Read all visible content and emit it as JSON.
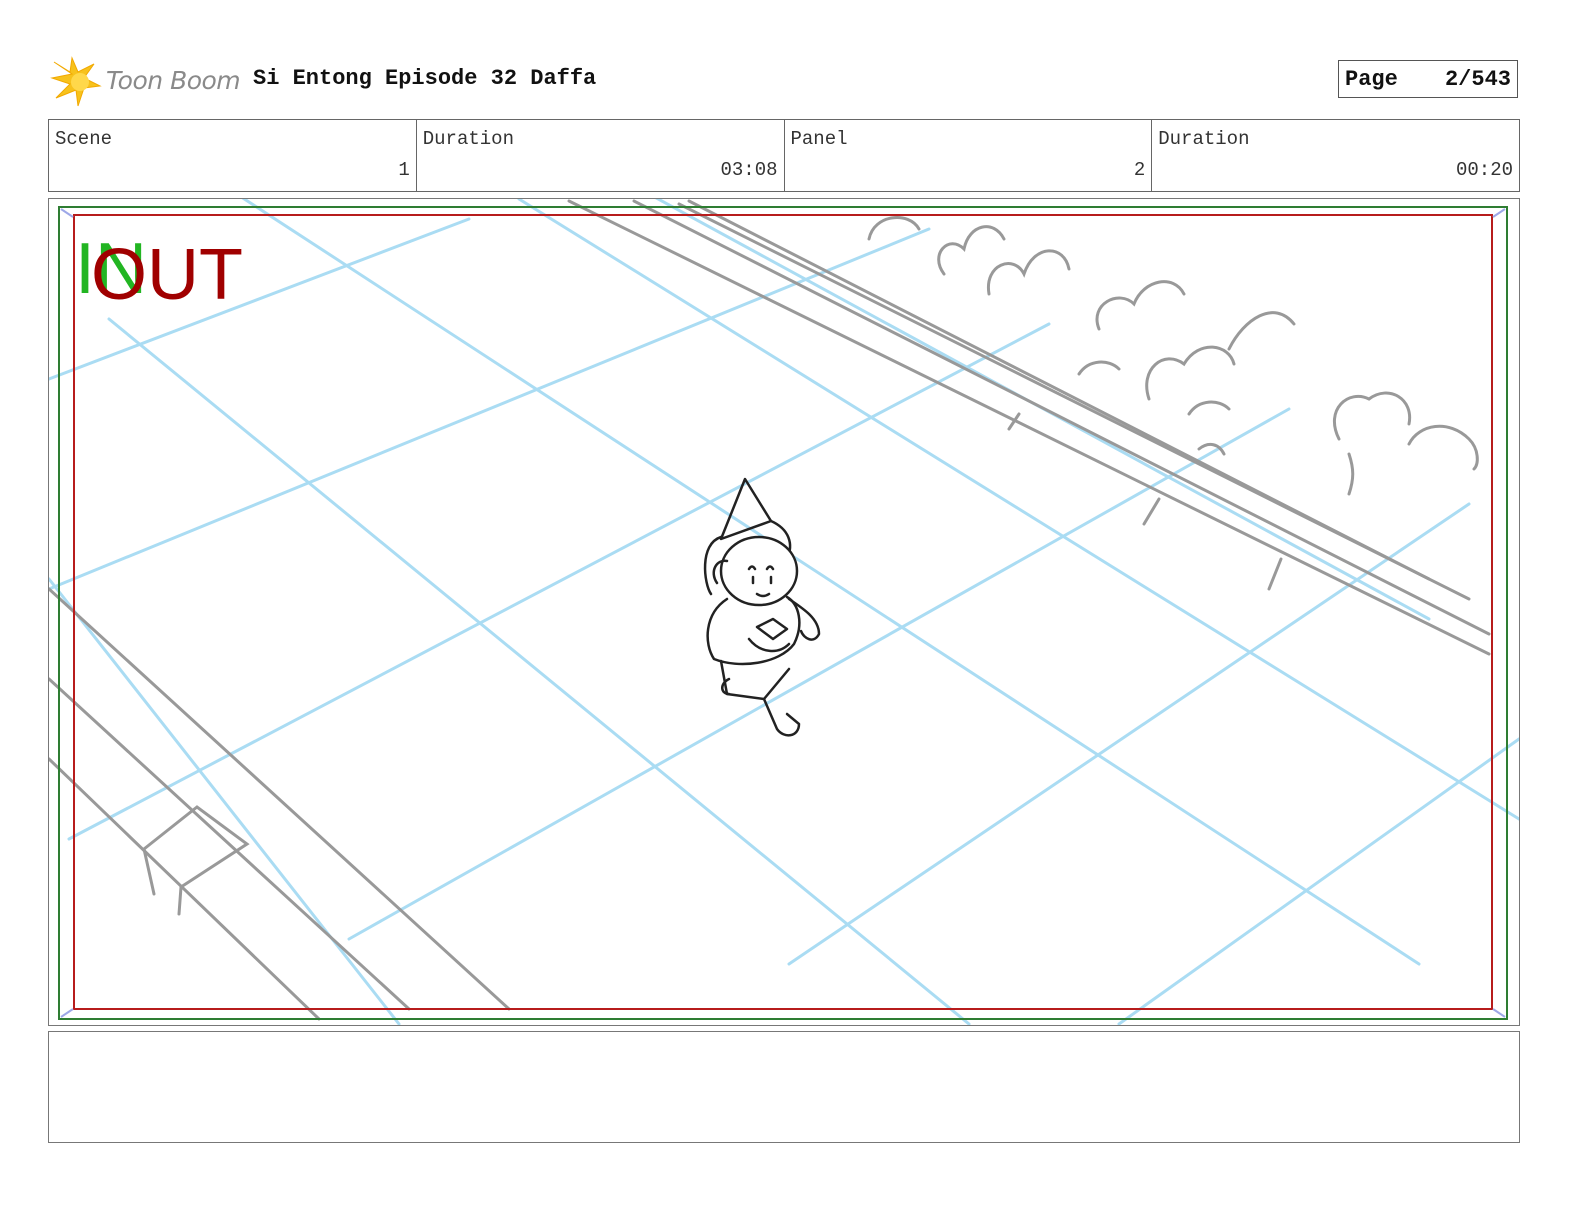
{
  "header": {
    "logo_text": "Toon Boom",
    "title": "Si Entong Episode 32 Daffa",
    "page_label": "Page",
    "page_value": "2/543"
  },
  "info": [
    {
      "label": "Scene",
      "value": "1"
    },
    {
      "label": "Duration",
      "value": "03:08"
    },
    {
      "label": "Panel",
      "value": "2"
    },
    {
      "label": "Duration",
      "value": "00:20"
    }
  ],
  "panel": {
    "in_marker": "IN",
    "out_marker": "OUT",
    "colors": {
      "safe_frame": "#b71c1c",
      "camera_frame": "#2e7d32",
      "grid": "#aadcf3",
      "sketch": "#999999",
      "character": "#222222"
    }
  },
  "notes": {
    "text": ""
  },
  "icons": {
    "logo": "toon-boom-logo-icon"
  }
}
